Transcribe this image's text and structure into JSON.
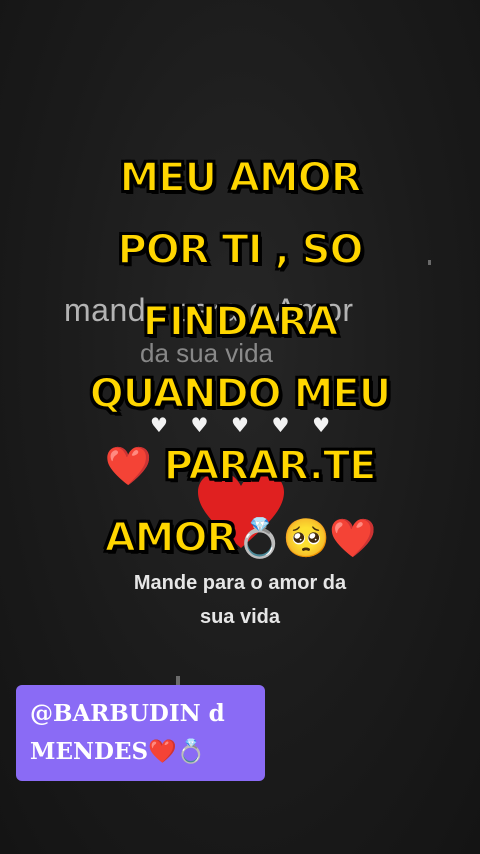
{
  "background_text": {
    "title": "mande para o Amor",
    "subtitle": "da sua vida"
  },
  "hearts_row": [
    "♥",
    "♥",
    "♥",
    "♥",
    "♥"
  ],
  "send_caption": {
    "line1": "Mande para o amor da",
    "line2": "sua vida"
  },
  "headline": {
    "line1": "MEU AMOR",
    "line2": "POR TI , SO",
    "line3": "FINDARA",
    "line4": "QUANDO MEU",
    "line5_heart": "❤️",
    "line5_text": "PARAR.TE",
    "line6_text": "AMOR",
    "line6_ring": "💍",
    "line6_face": "🥺",
    "line6_heart": "❤️"
  },
  "username_tag": {
    "line1": "@BARBUDIN d",
    "line2_text": "MENDES",
    "line2_heart": "❤️",
    "line2_ring": "💍"
  },
  "colors": {
    "headline": "#ffd600",
    "tag_background": "#8a6bf5",
    "background": "#1a1a1a",
    "heart": "#e02020"
  }
}
